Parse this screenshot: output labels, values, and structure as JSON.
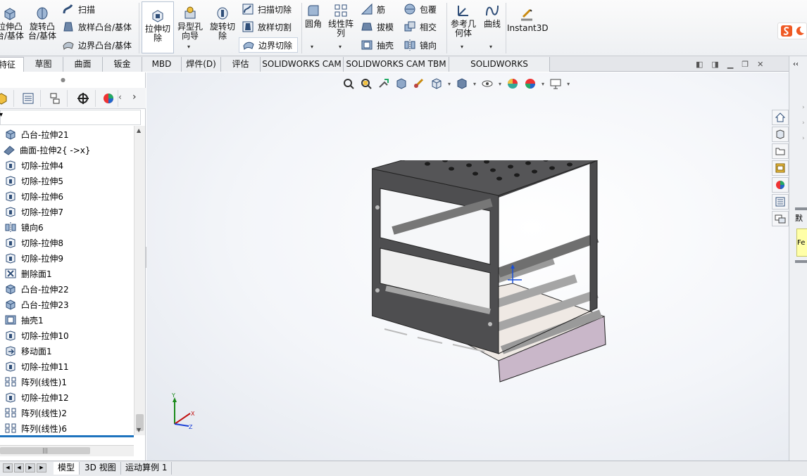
{
  "ribbon": {
    "extrude_boss_lines": [
      "拉伸凸",
      "台/基体"
    ],
    "revolve_boss_lines": [
      "旋转凸",
      "台/基体"
    ],
    "sweep": "扫描",
    "loft_boss": "放样凸台/基体",
    "boundary_boss": "边界凸台/基体",
    "extrude_cut_lines": [
      "拉伸切",
      "除"
    ],
    "hole_wizard_lines": [
      "异型孔",
      "向导"
    ],
    "revolve_cut_lines": [
      "旋转切",
      "除"
    ],
    "swept_cut": "扫描切除",
    "lofted_cut": "放样切割",
    "boundary_cut": "边界切除",
    "fillet": "圆角",
    "linear_pattern_lines": [
      "线性阵",
      "列"
    ],
    "rib": "筋",
    "draft": "拔模",
    "shell": "抽壳",
    "wrap": "包覆",
    "intersect": "相交",
    "mirror": "镜向",
    "ref_geometry_lines": [
      "参考几",
      "何体"
    ],
    "curves": "曲线",
    "instant3d": "Instant3D"
  },
  "tabs": [
    "特征",
    "草图",
    "曲面",
    "钣金",
    "MBD",
    "焊件(D)",
    "评估",
    "SOLIDWORKS CAM",
    "SOLIDWORKS CAM TBM",
    "SOLIDWORKS Inspection"
  ],
  "feature_tree": [
    {
      "label": "凸台-拉伸21",
      "icon": "boss-extrude-icon"
    },
    {
      "label": "曲面-拉伸2{ ->x}",
      "icon": "surface-extrude-icon"
    },
    {
      "label": "切除-拉伸4",
      "icon": "cut-extrude-icon"
    },
    {
      "label": "切除-拉伸5",
      "icon": "cut-extrude-icon"
    },
    {
      "label": "切除-拉伸6",
      "icon": "cut-extrude-icon"
    },
    {
      "label": "切除-拉伸7",
      "icon": "cut-extrude-icon"
    },
    {
      "label": "镜向6",
      "icon": "mirror-icon"
    },
    {
      "label": "切除-拉伸8",
      "icon": "cut-extrude-icon"
    },
    {
      "label": "切除-拉伸9",
      "icon": "cut-extrude-icon"
    },
    {
      "label": "删除面1",
      "icon": "delete-face-icon"
    },
    {
      "label": "凸台-拉伸22",
      "icon": "boss-extrude-icon"
    },
    {
      "label": "凸台-拉伸23",
      "icon": "boss-extrude-icon"
    },
    {
      "label": "抽壳1",
      "icon": "shell-icon"
    },
    {
      "label": "切除-拉伸10",
      "icon": "cut-extrude-icon"
    },
    {
      "label": "移动面1",
      "icon": "move-face-icon"
    },
    {
      "label": "切除-拉伸11",
      "icon": "cut-extrude-icon"
    },
    {
      "label": "阵列(线性)1",
      "icon": "linear-pattern-icon"
    },
    {
      "label": "切除-拉伸12",
      "icon": "cut-extrude-icon"
    },
    {
      "label": "阵列(线性)2",
      "icon": "linear-pattern-icon"
    },
    {
      "label": "阵列(线性)6",
      "icon": "linear-pattern-icon"
    }
  ],
  "bottom_tabs": [
    "模型",
    "3D 视图",
    "运动算例 1"
  ],
  "triad": {
    "x": "X",
    "y": "Y",
    "z": "Z"
  },
  "right_strip": {
    "text1": "默",
    "text2": "Fe"
  },
  "colors": {
    "accent": "#1e73be",
    "body": "#4a4a4c",
    "tray": "#c9b7c9"
  }
}
